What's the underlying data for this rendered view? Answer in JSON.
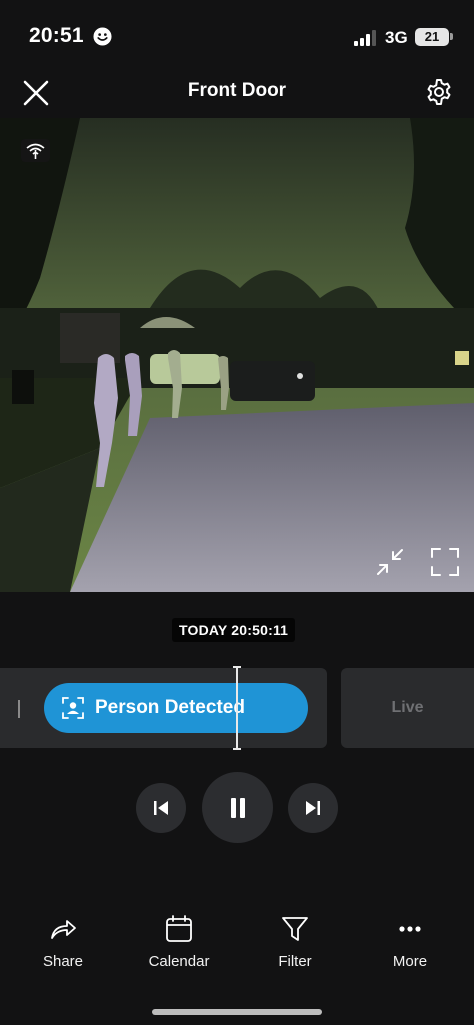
{
  "status_bar": {
    "time": "20:51",
    "network": "3G",
    "battery": "21"
  },
  "header": {
    "title": "Front Door"
  },
  "player": {
    "timestamp": "TODAY 20:50:11"
  },
  "timeline": {
    "event_label": "Person Detected",
    "live_label": "Live"
  },
  "nav": {
    "share": "Share",
    "calendar": "Calendar",
    "filter": "Filter",
    "more": "More"
  },
  "icons": {
    "close": "close-icon",
    "settings": "gear-icon",
    "wifi": "wifi-signal-icon",
    "minimize": "minimize-icon",
    "fullscreen": "fullscreen-icon",
    "person": "person-icon",
    "previous": "skip-previous-icon",
    "pause": "pause-icon",
    "next": "skip-next-icon",
    "share": "share-icon",
    "calendar": "calendar-icon",
    "filter": "filter-icon",
    "more": "more-icon"
  },
  "colors": {
    "accent": "#1f94d6",
    "background": "#121213",
    "card": "#2a2b2d"
  }
}
